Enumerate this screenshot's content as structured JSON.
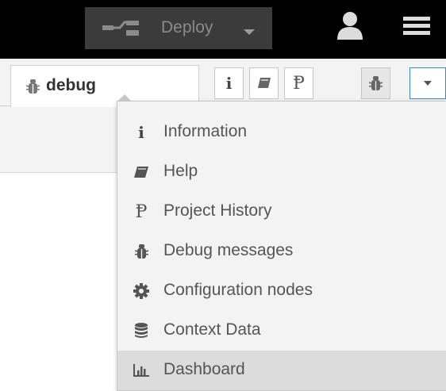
{
  "header": {
    "deploy_label": "Deploy",
    "deploy_icon": "deploy-icon",
    "user_icon": "user-icon",
    "menu_icon": "hamburger-menu-icon"
  },
  "sidebar": {
    "active_tab_label": "debug",
    "active_tab_icon": "bug-icon",
    "toolbar_buttons": [
      {
        "name": "info",
        "icon": "info-icon"
      },
      {
        "name": "help",
        "icon": "book-icon"
      },
      {
        "name": "project-history",
        "icon": "branch-icon"
      },
      {
        "name": "debug",
        "icon": "bug-icon",
        "active": true
      },
      {
        "name": "more",
        "icon": "caret-down-icon"
      }
    ]
  },
  "menu": {
    "items": [
      {
        "label": "Information",
        "icon": "info-icon"
      },
      {
        "label": "Help",
        "icon": "book-icon"
      },
      {
        "label": "Project History",
        "icon": "branch-icon"
      },
      {
        "label": "Debug messages",
        "icon": "bug-icon"
      },
      {
        "label": "Configuration nodes",
        "icon": "gear-icon"
      },
      {
        "label": "Context Data",
        "icon": "database-icon"
      },
      {
        "label": "Dashboard",
        "icon": "bar-chart-icon",
        "highlighted": true
      }
    ]
  },
  "colors": {
    "header_bg": "#000000",
    "deploy_bg": "#3b3b3b",
    "menu_bg": "#f3f3f3",
    "highlight_bg": "#dcdcdc",
    "focus_border": "#3f86c9"
  }
}
